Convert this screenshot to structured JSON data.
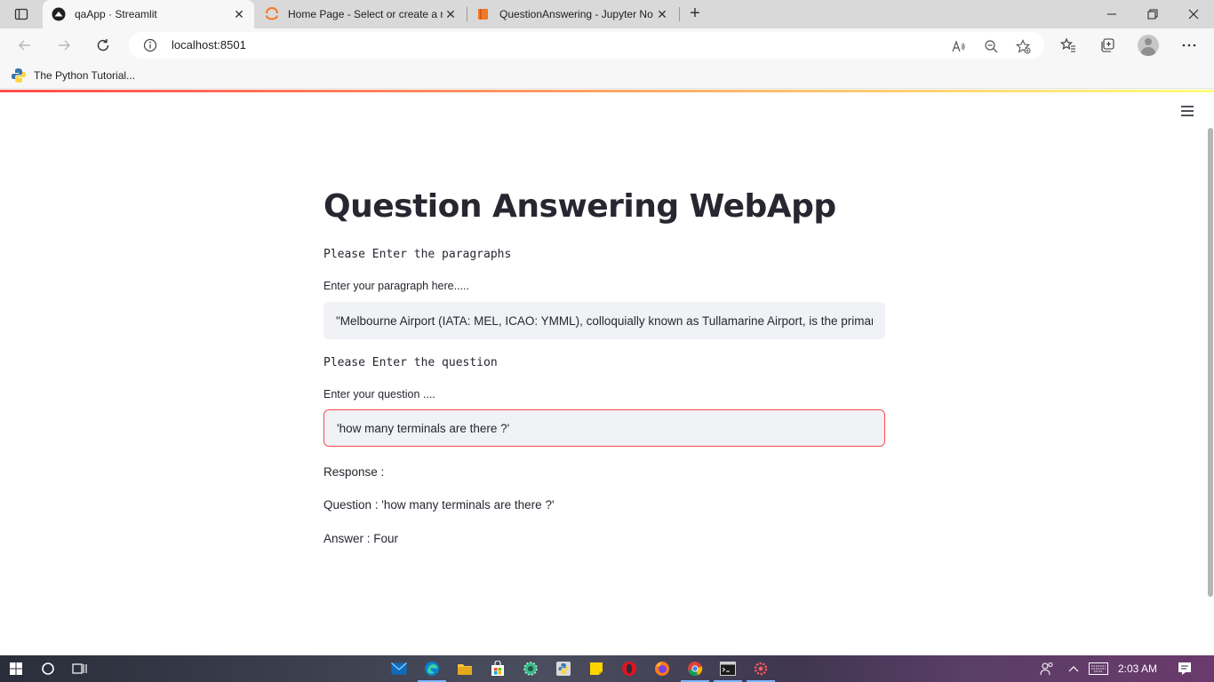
{
  "browser": {
    "tabs": [
      {
        "title": "qaApp · Streamlit",
        "icon": "streamlit-icon",
        "active": true
      },
      {
        "title": "Home Page - Select or create a n",
        "icon": "jupyter-icon",
        "active": false
      },
      {
        "title": "QuestionAnswering - Jupyter No",
        "icon": "notebook-icon",
        "active": false
      }
    ],
    "new_tab_symbol": "+",
    "address": "localhost:8501",
    "bookmarks": [
      {
        "label": "The Python Tutorial...",
        "icon": "python-icon"
      }
    ]
  },
  "app": {
    "title": "Question Answering WebApp",
    "paragraph_header": "Please Enter the paragraphs",
    "paragraph_label": "Enter your paragraph here.....",
    "paragraph_value": "\"Melbourne Airport (IATA: MEL, ICAO: YMML), colloquially known as Tullamarine Airport, is the primary",
    "question_header": "Please Enter the question",
    "question_label": "Enter your question ....",
    "question_value": "'how many terminals are there ?'",
    "response_label": "Response :",
    "question_echo": "Question : 'how many terminals are there ?'",
    "answer_line": "Answer : Four"
  },
  "taskbar": {
    "clock": "2:03 AM",
    "apps": [
      "mail-icon",
      "edge-icon",
      "file-explorer-icon",
      "store-icon",
      "settings-gear-icon",
      "python-app-icon",
      "sticky-notes-icon",
      "opera-icon",
      "firefox-icon",
      "chrome-icon",
      "terminal-icon",
      "app-gear-icon"
    ]
  },
  "colors": {
    "accent": "#ff4b4b",
    "input_background": "#f0f2f6",
    "text": "#262730"
  }
}
